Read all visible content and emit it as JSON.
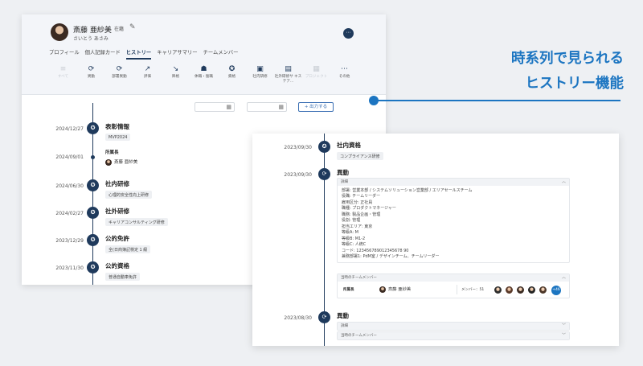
{
  "profile": {
    "name": "斎藤 亜紗美",
    "status": "在籍",
    "kana": "さいとう あさみ",
    "menu_icon": "⋯"
  },
  "tabs": [
    {
      "label": "プロフィール",
      "active": false
    },
    {
      "label": "個人記録カード",
      "active": false
    },
    {
      "label": "ヒストリー",
      "active": true
    },
    {
      "label": "キャリアサマリー",
      "active": false
    },
    {
      "label": "チームメンバー",
      "active": false
    }
  ],
  "categories": [
    {
      "label": "すべて",
      "icon": "≡",
      "disabled": true
    },
    {
      "label": "異動",
      "icon": "⟳",
      "disabled": false
    },
    {
      "label": "部署異動",
      "icon": "⟳",
      "disabled": false
    },
    {
      "label": "評価",
      "icon": "↗",
      "disabled": false
    },
    {
      "label": "降格",
      "icon": "↘",
      "disabled": false
    },
    {
      "label": "休職・復職",
      "icon": "☗",
      "disabled": false
    },
    {
      "label": "資格",
      "icon": "✪",
      "disabled": false
    },
    {
      "label": "社内研修",
      "icon": "▣",
      "disabled": false
    },
    {
      "label": "社外研修サ キステア...",
      "icon": "▤",
      "disabled": false
    },
    {
      "label": "プロジェクト",
      "icon": "▦",
      "disabled": true
    },
    {
      "label": "その他",
      "icon": "⋯",
      "disabled": false
    }
  ],
  "filter": {
    "export_label": "+ 出力する",
    "tilde": "〜"
  },
  "timeline_left": [
    {
      "date": "2024/12/27",
      "title": "表彰情報",
      "chip": "MVP2024",
      "icon": "✪"
    },
    {
      "date": "2024/09/01",
      "sub": "所属長",
      "person": "斎藤 亜紗美",
      "dot": true
    },
    {
      "date": "2024/06/30",
      "title": "社内研修",
      "chip": "心理的安全性向上研修",
      "icon": "✪"
    },
    {
      "date": "2024/02/27",
      "title": "社外研修",
      "chip": "キャリアコンサルティング研修",
      "icon": "✪"
    },
    {
      "date": "2023/12/29",
      "title": "公的免許",
      "chip": "全(日商簿記検定 1 級",
      "icon": "✪"
    },
    {
      "date": "2023/11/30",
      "title": "公的資格",
      "chip": "普通自動車免許",
      "icon": "✪"
    }
  ],
  "headline": {
    "line1": "時系列で見られる",
    "line2": "ヒストリー機能"
  },
  "timeline_right": {
    "ev1": {
      "date": "2023/09/30",
      "title": "社内資格",
      "chip": "コンプライアンス研修",
      "icon": "✪"
    },
    "ev2": {
      "date": "2023/09/30",
      "title": "異動",
      "icon": "⟳",
      "detail_head": "詳細",
      "details": [
        "部署: 営業本部 / システムソリューション営業部 / エリアセールスチーム",
        "役職: チームリーダー",
        "雇用区分: 正社員",
        "職種: プロダクトマネージャー",
        "職務: 製品企画・管理",
        "役割: 管理",
        "担当エリア: 東京",
        "等級A: M",
        "等級B: M1-2",
        "等級C: 人統C",
        "コード: 123456789012345678 90",
        "兼務部署1: PdM室 / デザインチーム、チームリーダー"
      ],
      "members_head": "当時のチームメンバー",
      "manager_label": "所属長",
      "manager_name": "斎藤 亜紗美",
      "member_count": "メンバー：51",
      "more": "+46"
    },
    "ev3": {
      "date": "2023/08/30",
      "title": "異動",
      "icon": "⟳",
      "detail_head": "詳細",
      "members_head": "当時のチームメンバー"
    }
  },
  "colors": {
    "navy": "#1f3a5c",
    "accent": "#1c75c1"
  }
}
